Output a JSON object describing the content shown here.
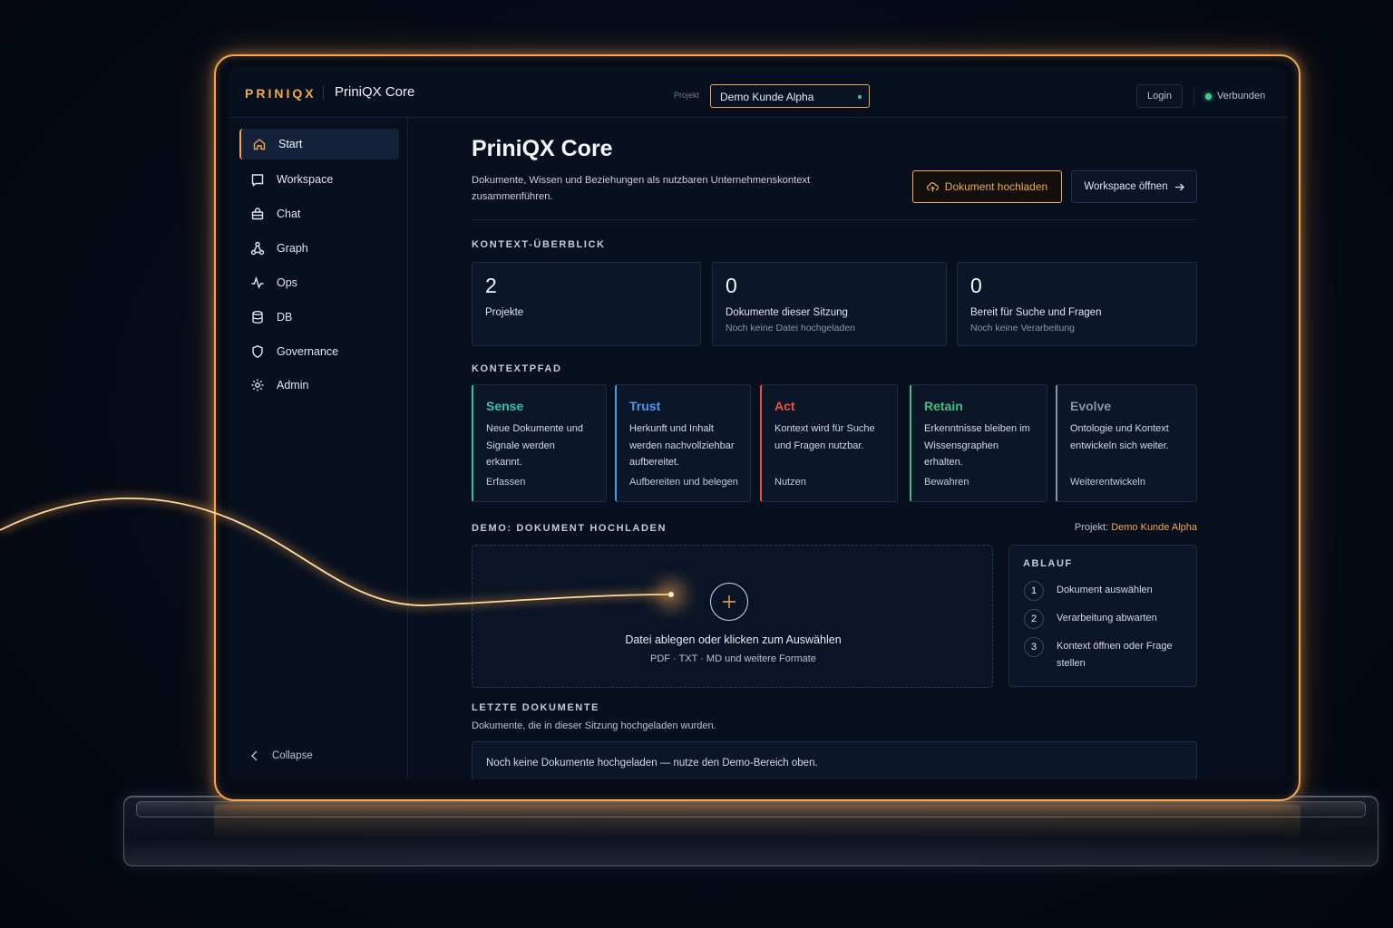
{
  "header": {
    "brand": "PRINIQX",
    "app_title": "PriniQX Core",
    "project_label": "Projekt",
    "project_value": "Demo Kunde Alpha",
    "login_label": "Login",
    "status_label": "Verbunden"
  },
  "sidebar": {
    "items": [
      {
        "label": "Start",
        "icon": "home-icon",
        "active": true
      },
      {
        "label": "Workspace",
        "icon": "book-icon"
      },
      {
        "label": "Chat",
        "icon": "chat-icon"
      },
      {
        "label": "Graph",
        "icon": "graph-icon"
      },
      {
        "label": "Ops",
        "icon": "pulse-icon"
      },
      {
        "label": "DB",
        "icon": "database-icon"
      },
      {
        "label": "Governance",
        "icon": "shield-icon"
      },
      {
        "label": "Admin",
        "icon": "gear-icon"
      }
    ],
    "collapse_label": "Collapse"
  },
  "main": {
    "title": "PriniQX Core",
    "subtitle": "Dokumente, Wissen und Beziehungen als nutzbaren Unternehmenskontext zusammenführen.",
    "upload_button": "Dokument hochladen",
    "workspace_button": "Workspace öffnen",
    "overview": {
      "heading": "KONTEXT-ÜBERBLICK",
      "stats": [
        {
          "value": "2",
          "label": "Projekte",
          "sub": ""
        },
        {
          "value": "0",
          "label": "Dokumente dieser Sitzung",
          "sub": "Noch keine Datei hochgeladen"
        },
        {
          "value": "0",
          "label": "Bereit für Suche und Fragen",
          "sub": "Noch keine Verarbeitung"
        }
      ]
    },
    "path": {
      "heading": "KONTEXTPFAD",
      "cards": [
        {
          "title": "Sense",
          "desc": "Neue Dokumente und Signale werden erkannt.",
          "tag": "Erfassen",
          "color": "#2ec4a6"
        },
        {
          "title": "Trust",
          "desc": "Herkunft und Inhalt werden nachvollziehbar aufbereitet.",
          "tag": "Aufbereiten und belegen",
          "color": "#4a9bea"
        },
        {
          "title": "Act",
          "desc": "Kontext wird für Suche und Fragen nutzbar.",
          "tag": "Nutzen",
          "color": "#ef5340"
        },
        {
          "title": "Retain",
          "desc": "Erkenntnisse bleiben im Wissensgraphen erhalten.",
          "tag": "Bewahren",
          "color": "#3fbf82"
        },
        {
          "title": "Evolve",
          "desc": "Ontologie und Kontext entwickeln sich weiter.",
          "tag": "Weiterentwickeln",
          "color": "#8a94a8"
        }
      ]
    },
    "demo": {
      "heading": "DEMO: DOKUMENT HOCHLADEN",
      "project_prefix": "Projekt:",
      "project_name": "Demo Kunde Alpha",
      "drop_text": "Datei ablegen oder klicken zum Auswählen",
      "formats": "PDF · TXT · MD und weitere Formate",
      "flow_heading": "ABLAUF",
      "steps": [
        {
          "n": "1",
          "text": "Dokument auswählen"
        },
        {
          "n": "2",
          "text": "Verarbeitung abwarten"
        },
        {
          "n": "3",
          "text": "Kontext öffnen oder Frage stellen"
        }
      ]
    },
    "recent": {
      "heading": "LETZTE DOKUMENTE",
      "sub": "Dokumente, die in dieser Sitzung hochgeladen wurden.",
      "empty": "Noch keine Dokumente hochgeladen — nutze den Demo-Bereich oben."
    }
  },
  "colors": {
    "accent": "#f0a84a",
    "connected": "#3ecf8e",
    "background": "#08101f"
  }
}
